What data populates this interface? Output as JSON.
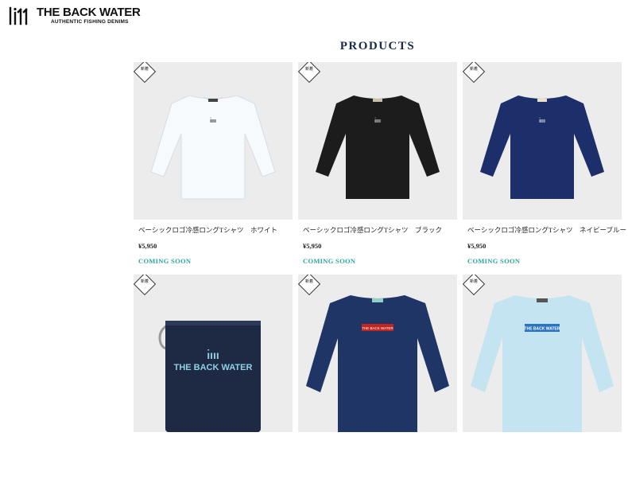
{
  "header": {
    "brand_name": "THE BACK WATER",
    "brand_tagline": "AUTHENTIC FISHING DENIMS",
    "logo_icon": "fish-hooks-logo-icon"
  },
  "page_title": "PRODUCTS",
  "products": [
    {
      "badge": "新着",
      "name": "ベーシックロゴ冷感ロングTシャツ　ホワイト",
      "price": "¥5,950",
      "status": "COMING SOON",
      "color": "#f7fafd",
      "icon": "longsleeve-shirt-icon"
    },
    {
      "badge": "新着",
      "name": "ベーシックロゴ冷感ロングTシャツ　ブラック",
      "price": "¥5,950",
      "status": "COMING SOON",
      "color": "#1c1c1c",
      "icon": "longsleeve-shirt-icon"
    },
    {
      "badge": "新着",
      "name": "ベーシックロゴ冷感ロングTシャツ　ネイビーブルー",
      "price": "¥5,950",
      "status": "COMING SOON",
      "color": "#1d2f6b",
      "icon": "longsleeve-shirt-icon"
    },
    {
      "badge": "新着",
      "color": "#1e2a44",
      "icon": "denim-pouch-icon",
      "print_text": "THE BACK WATER"
    },
    {
      "badge": "新着",
      "color": "#1f3566",
      "icon": "longsleeve-shirt-icon"
    },
    {
      "badge": "新着",
      "color": "#c5e4f1",
      "icon": "longsleeve-shirt-icon",
      "print_text": "THE BACK WATER"
    }
  ],
  "colors": {
    "accent": "#2ca89b",
    "title": "#1b2a4a",
    "image_bg": "#ececec"
  }
}
